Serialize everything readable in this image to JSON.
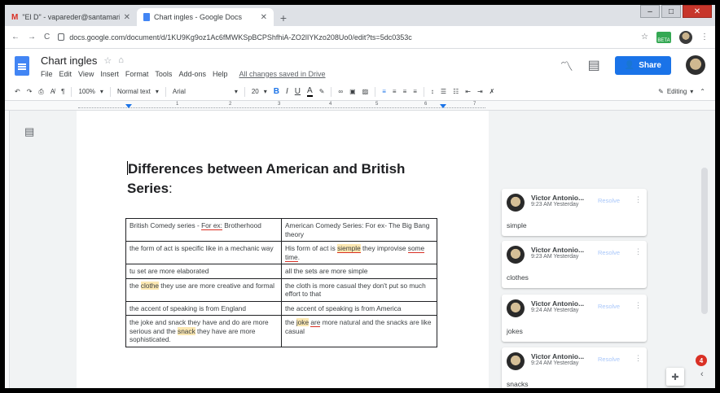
{
  "browser": {
    "tabs": [
      {
        "title": "\"El D\" - vapareder@santamaria.e",
        "icon": "gmail-icon"
      },
      {
        "title": "Chart ingles - Google Docs",
        "icon": "docs-icon"
      }
    ],
    "url": "docs.google.com/document/d/1KU9Kg9oz1Ac6fMWKSpBCPShfhiA-ZO2lIYKzo208Uo0/edit?ts=5dc0353c"
  },
  "doc_header": {
    "title": "Chart ingles",
    "menu": [
      "File",
      "Edit",
      "View",
      "Insert",
      "Format",
      "Tools",
      "Add-ons",
      "Help"
    ],
    "saved_status": "All changes saved in Drive",
    "share_label": "Share"
  },
  "toolbar": {
    "zoom": "100%",
    "style": "Normal text",
    "font": "Arial",
    "size": "20",
    "mode": "Editing"
  },
  "ruler_numbers": [
    "1",
    "2",
    "3",
    "4",
    "5",
    "6",
    "7"
  ],
  "document": {
    "heading_line1": "Differences between American and British",
    "heading_line2": "Series",
    "heading_colon": ":",
    "rows": [
      {
        "left": [
          "British Comedy series - ",
          "For ex:",
          " Brotherhood"
        ],
        "right": [
          "American Comedy Series: For ex- The Big Bang theory"
        ]
      },
      {
        "left": [
          "the form of act is specific like in a mechanic way"
        ],
        "right": [
          "His form of act is ",
          "siemple",
          " they improvise ",
          "some time",
          "."
        ]
      },
      {
        "left": [
          "tu set are more elaborated"
        ],
        "right": [
          "all the sets are more simple"
        ]
      },
      {
        "left": [
          "the ",
          "clothe",
          " they use are more creative and formal"
        ],
        "right": [
          "the cloth is more casual they don't put so much effort to that"
        ]
      },
      {
        "left": [
          "the accent of speaking is from England"
        ],
        "right": [
          "the accent of speaking is from America"
        ]
      },
      {
        "left": [
          "the joke and snack they have and do are more serious and the ",
          "snack",
          " they have are more sophisticated."
        ],
        "right": [
          "the ",
          "joke",
          " ",
          "are",
          " more natural and the snacks are like casual"
        ]
      }
    ]
  },
  "comments": [
    {
      "author": "Victor Antonio...",
      "time": "9:23 AM Yesterday",
      "resolve": "Resolve",
      "text": "simple"
    },
    {
      "author": "Victor Antonio...",
      "time": "9:23 AM Yesterday",
      "resolve": "Resolve",
      "text": "clothes"
    },
    {
      "author": "Victor Antonio...",
      "time": "9:24 AM Yesterday",
      "resolve": "Resolve",
      "text": "jokes"
    },
    {
      "author": "Victor Antonio...",
      "time": "9:24 AM Yesterday",
      "resolve": "Resolve",
      "text": "snacks"
    }
  ],
  "notification_count": "4",
  "colors": {
    "accent": "#1a73e8",
    "highlight": "#fce8b2",
    "spelling": "#d93025"
  }
}
